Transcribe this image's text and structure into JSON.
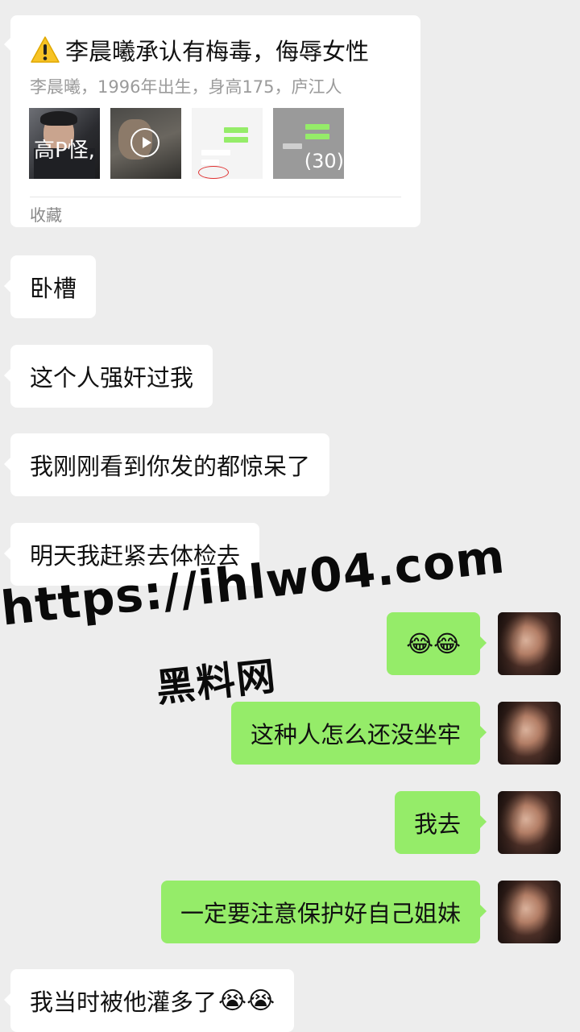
{
  "shared_card": {
    "title": "李晨曦承认有梅毒，侮辱女性",
    "subtitle": "李晨曦，1996年出生，身高175，庐江人",
    "thumb1_text": "高P怪,",
    "image_count": "(30)",
    "footer": "收藏"
  },
  "messages": [
    {
      "side": "in",
      "text": "卧槽"
    },
    {
      "side": "in",
      "text": "这个人强奸过我"
    },
    {
      "side": "in",
      "text": "我刚刚看到你发的都惊呆了"
    },
    {
      "side": "in",
      "text": "明天我赶紧去体检去"
    },
    {
      "side": "out",
      "text": "😂😂"
    },
    {
      "side": "out",
      "text": "这种人怎么还没坐牢"
    },
    {
      "side": "out",
      "text": "我去"
    },
    {
      "side": "out",
      "text": "一定要注意保护好自己姐妹"
    },
    {
      "side": "in",
      "text": "我当时被他灌多了",
      "emoji": "😭😭"
    }
  ],
  "watermark": {
    "url": "https://ihlw04.com",
    "name": "黑料网"
  }
}
